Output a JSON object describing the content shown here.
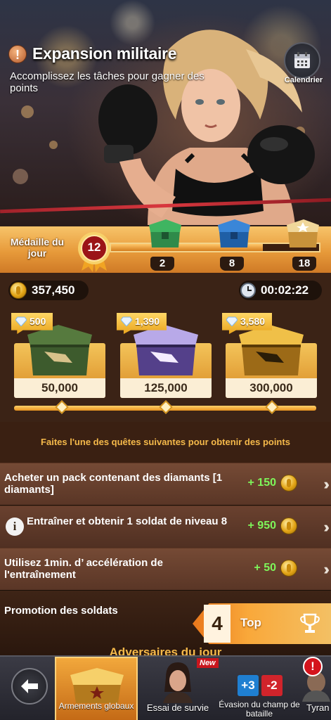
{
  "hero": {
    "title": "Expansion militaire",
    "subtitle": "Accomplissez les tâches pour gagner des points",
    "calendar_label": "Calendrier"
  },
  "medal": {
    "label": "Médaille du jour",
    "count": "12",
    "milestones": [
      "2",
      "8",
      "18"
    ]
  },
  "wallet": {
    "coins": "357,450",
    "timer": "00:02:22"
  },
  "chests": [
    {
      "diamonds": "500",
      "price": "50,000",
      "color": "#4b6a3a"
    },
    {
      "diamonds": "1,390",
      "price": "125,000",
      "color": "#6a4cb8"
    },
    {
      "diamonds": "3,580",
      "price": "300,000",
      "color": "#d99a22"
    }
  ],
  "quests_header": "Faites l'une des quêtes suivantes pour obtenir des points",
  "quests": [
    {
      "text": "Acheter un pack contenant des diamants [1 diamants]",
      "reward": "+ 150"
    },
    {
      "text": "Entraîner et obtenir 1 soldat de niveau 8",
      "reward": "+ 950"
    },
    {
      "text": "Utilisez 1min. d’ accélération de l'entraînement",
      "reward": "+ 50"
    }
  ],
  "promotion": {
    "title": "Promotion des soldats",
    "rank": "4",
    "rank_label": "Top"
  },
  "opponents_title": "Adversaires du jour",
  "nav": {
    "items": [
      {
        "label": "Armements globaux"
      },
      {
        "label": "Essai de survie"
      },
      {
        "label": "Évasion du champ de bataille"
      },
      {
        "label": "Tyran"
      }
    ],
    "new_badge": "New",
    "alert": "!",
    "score_left": "+3",
    "score_right": "-2"
  },
  "colors": {
    "accent_orange": "#e9771c",
    "reward_green": "#7ef55a",
    "header_gold": "#f5b94a"
  }
}
